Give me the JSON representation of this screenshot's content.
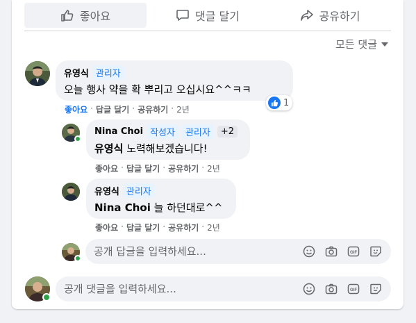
{
  "actions": {
    "like": "좋아요",
    "comment": "댓글 달기",
    "share": "공유하기"
  },
  "sort_label": "모든 댓글",
  "comments": [
    {
      "author": "유영식",
      "badge": "관리자",
      "text": "오늘 행사 약을 확 뿌리고 오십시요^^ㅋㅋ",
      "meta": {
        "like": "좋아요",
        "reply": "답글 달기",
        "share": "공유하기",
        "time": "2년"
      },
      "reaction_count": "1"
    }
  ],
  "replies": [
    {
      "author": "Nina Choi",
      "badges": [
        "작성자",
        "관리자"
      ],
      "extra": "+2",
      "mention": "유영식",
      "text": "노력해보겠습니다!",
      "meta": {
        "like": "좋아요",
        "reply": "답글 달기",
        "share": "공유하기",
        "time": "2년"
      }
    },
    {
      "author": "유영식",
      "badges": [
        "관리자"
      ],
      "mention": "Nina Choi",
      "text": "늘 하던대로^^",
      "meta": {
        "like": "좋아요",
        "reply": "답글 달기",
        "share": "공유하기",
        "time": "2년"
      }
    }
  ],
  "reply_input": {
    "placeholder": "공개 답글을 입력하세요..."
  },
  "comment_input": {
    "placeholder": "공개 댓글을 입력하세요..."
  },
  "colors": {
    "accent": "#1877f2",
    "online": "#31a24c",
    "bubble": "#f0f2f5",
    "muted": "#65676b"
  }
}
